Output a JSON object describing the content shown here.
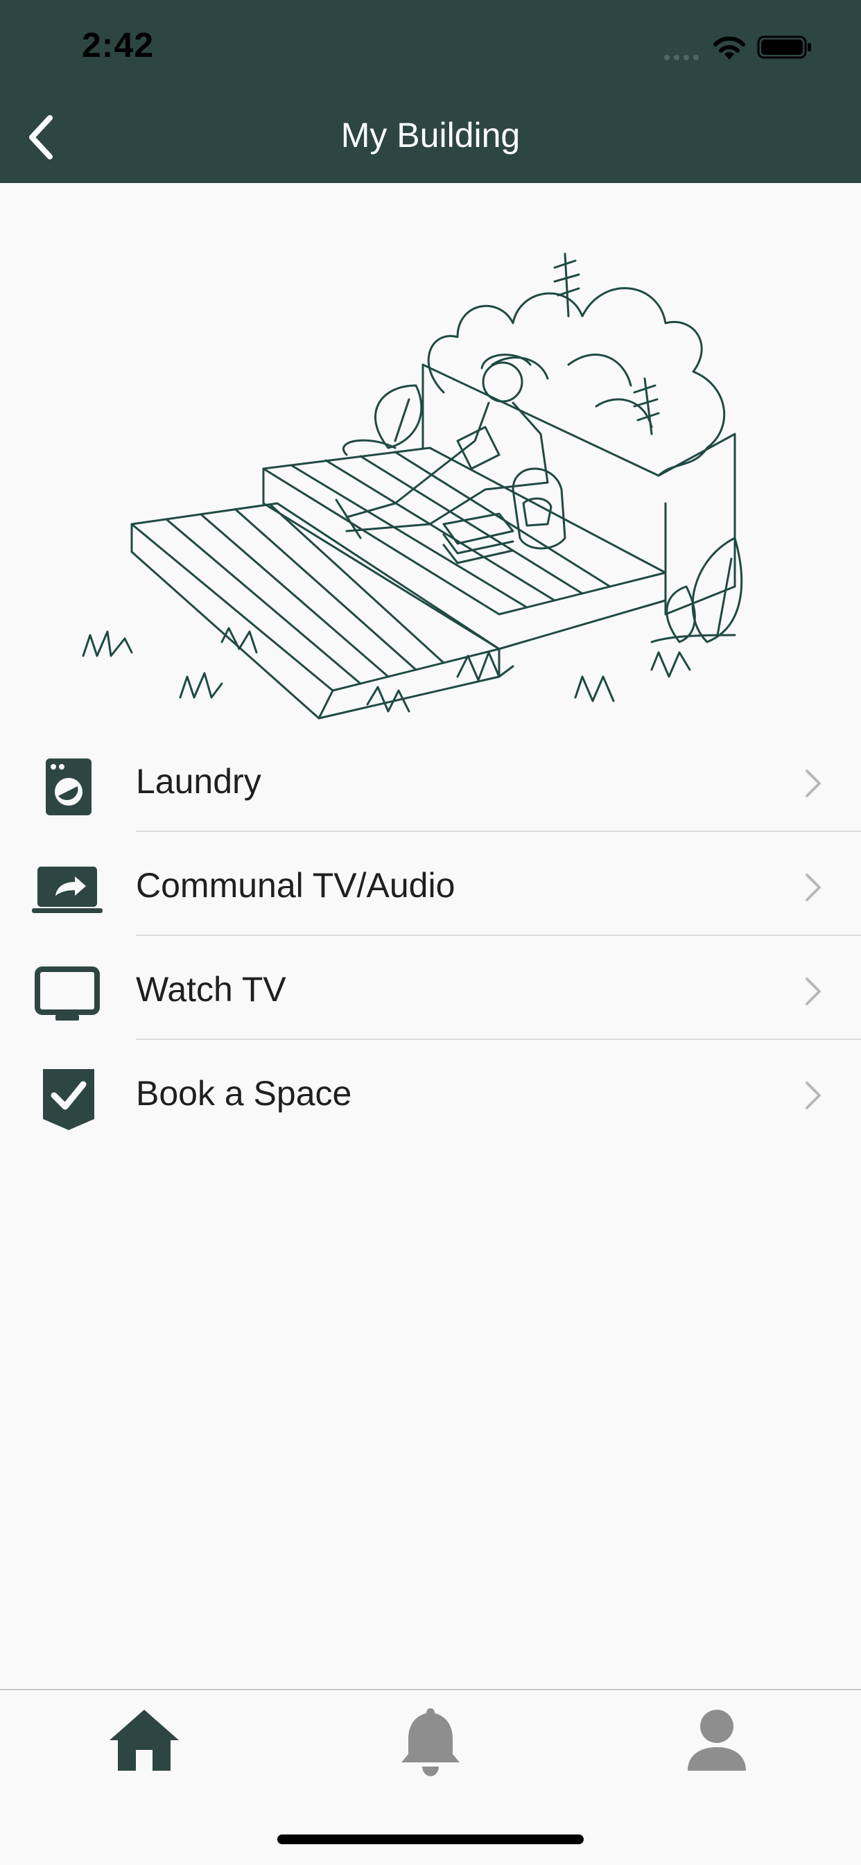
{
  "status_bar": {
    "time": "2:42"
  },
  "nav": {
    "title": "My Building",
    "back_icon": "chevron-left-icon"
  },
  "menu": {
    "items": [
      {
        "label": "Laundry",
        "icon": "washing-machine-icon"
      },
      {
        "label": "Communal TV/Audio",
        "icon": "screen-share-icon"
      },
      {
        "label": "Watch TV",
        "icon": "tv-icon"
      },
      {
        "label": "Book a Space",
        "icon": "checkmark-badge-icon"
      }
    ]
  },
  "tabs": [
    {
      "name": "home",
      "icon": "home-icon",
      "active": true
    },
    {
      "name": "notifications",
      "icon": "bell-icon",
      "active": false
    },
    {
      "name": "profile",
      "icon": "person-icon",
      "active": false
    }
  ],
  "colors": {
    "header_bg": "#2d4642",
    "accent": "#2d4642",
    "inactive_tab": "#8e8e8e",
    "chevron": "#b8b8b8",
    "divider": "#dcdcdc"
  }
}
